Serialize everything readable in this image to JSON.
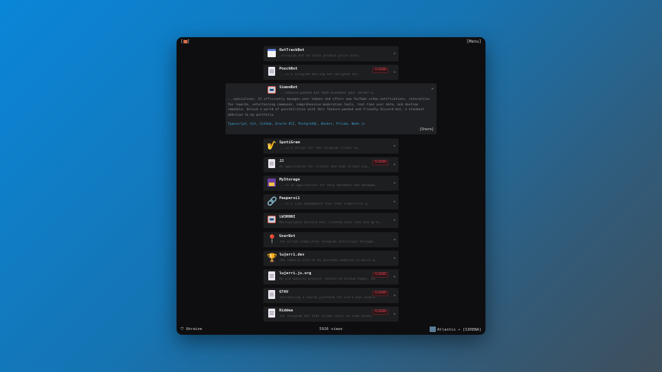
{
  "header": {
    "brand": "[",
    "brand_close": "]",
    "menu": "[Menu]"
  },
  "cards": [
    {
      "icon": "calendar-icon",
      "title": "OutTrackBot",
      "desc": "…telegram bot to track product price with…",
      "closed": false
    },
    {
      "icon": "document-icon",
      "title": "PouchBot",
      "desc": "...is a Telegram mailing bot designed for…",
      "closed": true
    },
    {
      "icon": "robot-icon",
      "title": "SimonBot",
      "desc": "...feature-packed bot that elevates your server's…",
      "closed": false,
      "expanded": true,
      "body": "...specializes. It efficiently manages user tokens and offers new YouTube video notifications, interactive fun rewards, entertaining commands, comprehensive moderation tools, real-time user data, and devtime remodule. Unlock a world of possibilities with this feature-packed and friendly discord bot, a standout addition to my portfolio.",
      "tags": "Typescript, Git, GitHub, Oracle OCI, PostgreSQL, Docker, Prisma, Node js",
      "share": "[Share]"
    },
    {
      "icon": "saxophone-icon",
      "title": "SpotiGram",
      "desc": "...is a script for the Telegram client to…",
      "closed": false
    },
    {
      "icon": "document-icon",
      "title": "JJ",
      "desc": "An application for clients and that allows you…",
      "closed": true
    },
    {
      "icon": "floppy-icon",
      "title": "MyStorage",
      "desc": "...is an application for easy document and managem…",
      "closed": false
    },
    {
      "icon": "link-icon",
      "title": "Paupersi1",
      "desc": "...is a link management tool that simplifies y…",
      "closed": false
    },
    {
      "icon": "robot-icon",
      "title": "LW3RNNI",
      "desc": "Multipurpose Discord bot, created with love and my b…",
      "closed": false
    },
    {
      "icon": "pushpin-icon",
      "title": "UserBot",
      "desc": "The script simplifies Telegram activities through…",
      "closed": false
    },
    {
      "icon": "trophy-icon",
      "title": "lwjerri.dev",
      "desc": "The rebuild site of my personal website is built w…",
      "closed": false
    },
    {
      "icon": "document-icon",
      "title": "lwjerri.js.org",
      "desc": "My old website project, hosted on Github Pages, de…",
      "closed": true
    },
    {
      "icon": "document-icon",
      "title": "GTAV",
      "desc": "Introducing a search platform for GTA V mod lovers…",
      "closed": true
    },
    {
      "icon": "document-icon",
      "title": "Riddea",
      "desc": "The Telegram bot that allows users to view anime…",
      "closed": true
    }
  ],
  "closed_label": "CLOSED",
  "footer": {
    "location": "Ukraine",
    "views": "5926 views",
    "music_artist": "Atlantis",
    "music_arrow": "→",
    "music_track": "[SIRENA]"
  }
}
